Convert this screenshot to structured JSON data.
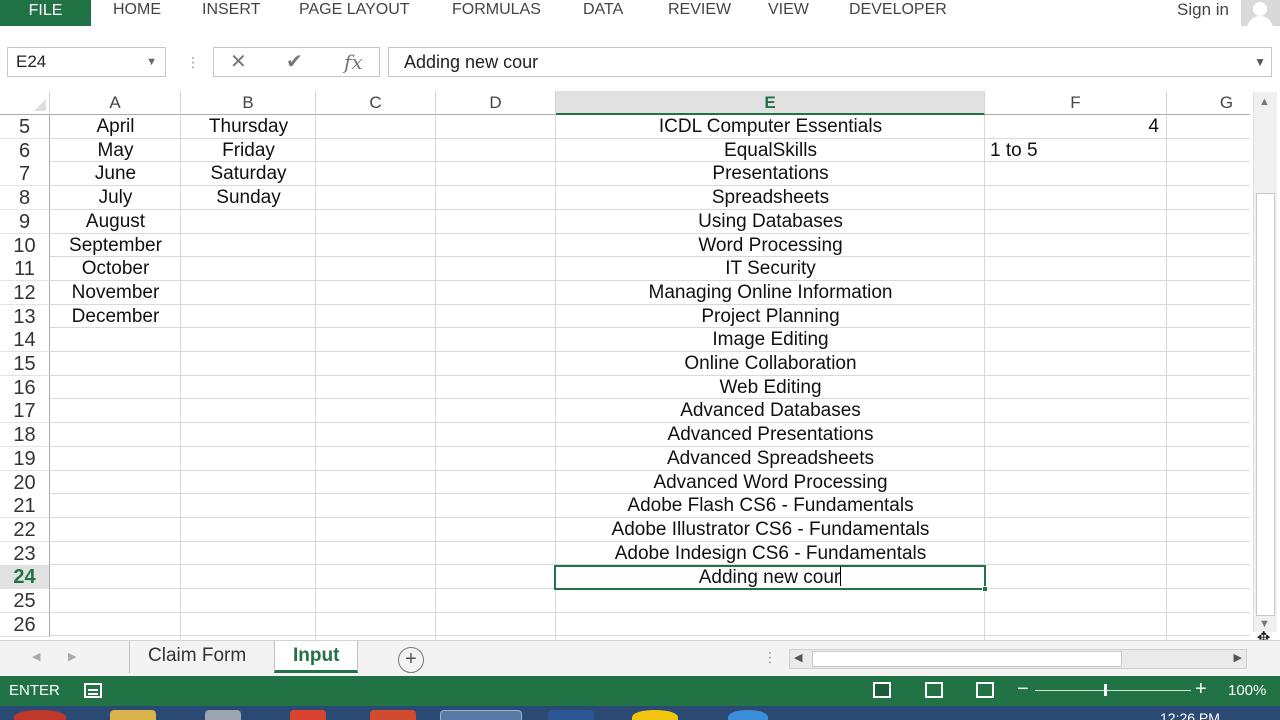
{
  "ribbon": {
    "file_tab": "FILE",
    "tabs": [
      "HOME",
      "INSERT",
      "PAGE LAYOUT",
      "FORMULAS",
      "DATA",
      "REVIEW",
      "VIEW",
      "DEVELOPER"
    ],
    "sign_in": "Sign in"
  },
  "formula_bar": {
    "name_box": "E24",
    "cancel_icon": "✕",
    "enter_icon": "✔",
    "fx_icon": "fx",
    "content": "Adding new cour"
  },
  "grid": {
    "columns": [
      "A",
      "B",
      "C",
      "D",
      "E",
      "F",
      "G"
    ],
    "selected_column": "E",
    "rows": [
      "5",
      "6",
      "7",
      "8",
      "9",
      "10",
      "11",
      "12",
      "13",
      "14",
      "15",
      "16",
      "17",
      "18",
      "19",
      "20",
      "21",
      "22",
      "23",
      "24",
      "25",
      "26"
    ],
    "selected_row": "24",
    "column_a": [
      "April",
      "May",
      "June",
      "July",
      "August",
      "September",
      "October",
      "November",
      "December"
    ],
    "column_b": [
      "Thursday",
      "Friday",
      "Saturday",
      "Sunday"
    ],
    "column_e": [
      "ICDL Computer Essentials",
      "EqualSkills",
      "Presentations",
      "Spreadsheets",
      "Using Databases",
      "Word Processing",
      "IT Security",
      "Managing Online Information",
      "Project Planning",
      "Image Editing",
      "Online Collaboration",
      "Web Editing",
      "Advanced Databases",
      "Advanced Presentations",
      "Advanced Spreadsheets",
      "Advanced Word Processing",
      "Adobe Flash CS6 - Fundamentals",
      "Adobe Illustrator CS6 - Fundamentals",
      "Adobe Indesign CS6 - Fundamentals"
    ],
    "column_f": {
      "f5": "4",
      "f6": "1 to 5"
    },
    "active_cell_text": "Adding new cour"
  },
  "sheets": {
    "tabs": [
      "Claim Form",
      "Input"
    ],
    "active": "Input",
    "add_icon": "+"
  },
  "status_bar": {
    "mode": "ENTER",
    "zoom": "100%",
    "zoom_fraction": 0.5
  },
  "taskbar": {
    "clock": "12:26 PM"
  },
  "colors": {
    "accent": "#217346",
    "taskbar": "#2b4a73"
  },
  "icons": [
    "name-box-dropdown-icon",
    "cancel-icon",
    "enter-icon",
    "function-icon",
    "formula-expand-icon",
    "macro-record-icon",
    "normal-view-icon",
    "page-layout-view-icon",
    "page-break-view-icon",
    "add-sheet-icon"
  ]
}
